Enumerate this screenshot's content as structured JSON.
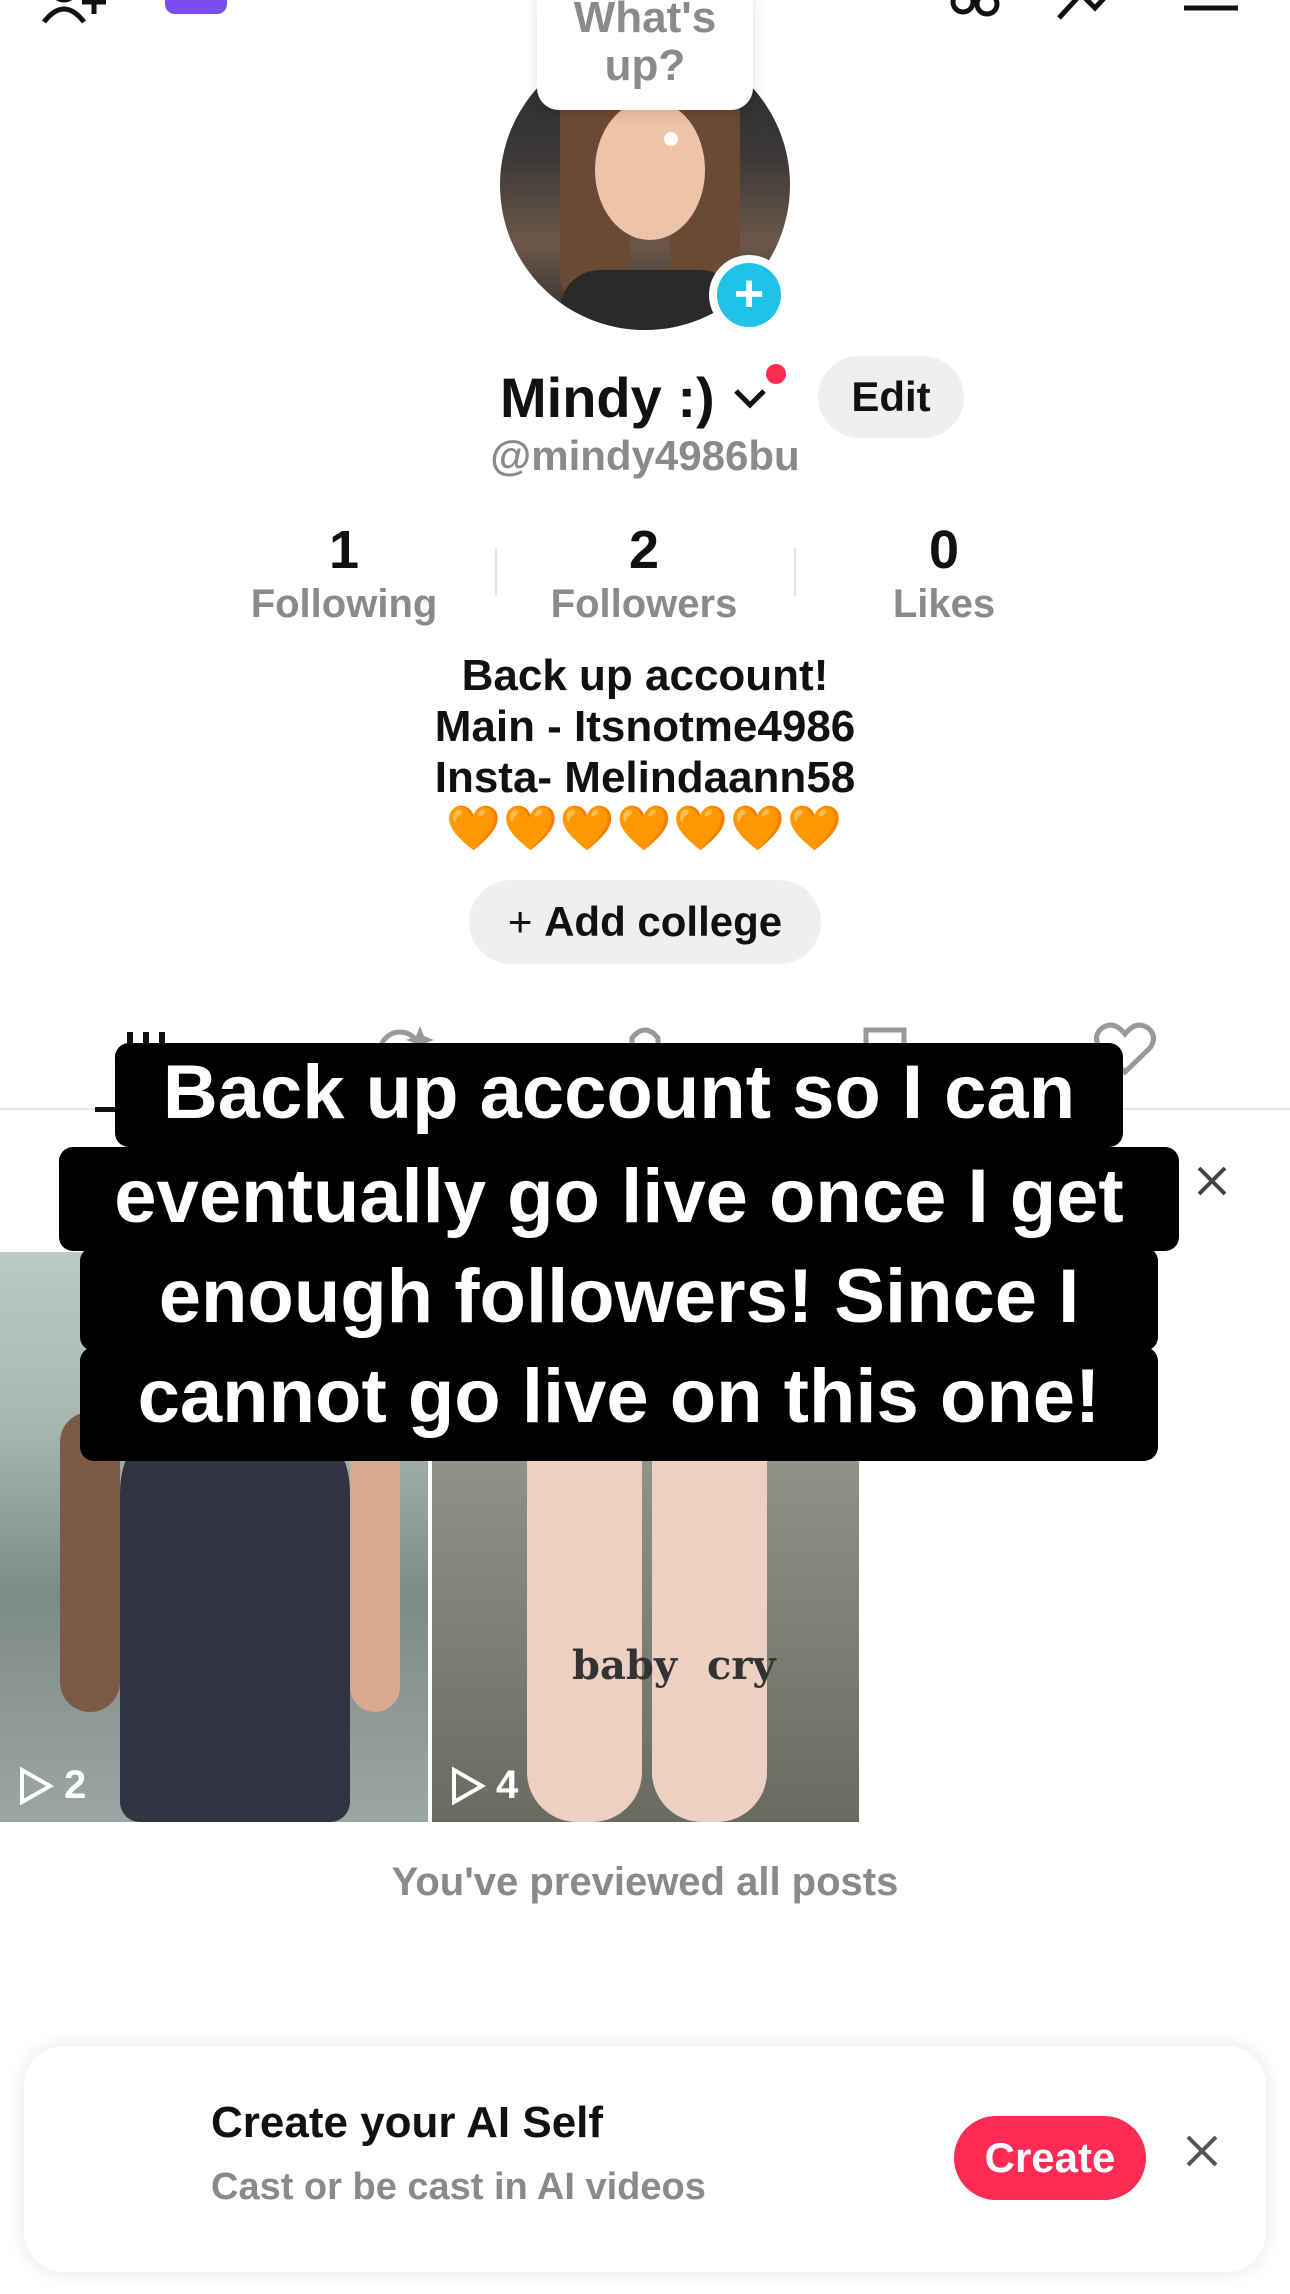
{
  "bubble": {
    "text_line1": "What's",
    "text_line2": "up?"
  },
  "profile": {
    "name": "Mindy :)",
    "handle": "@mindy4986bu",
    "edit_label": "Edit",
    "stats": [
      {
        "value": "1",
        "label": "Following"
      },
      {
        "value": "2",
        "label": "Followers"
      },
      {
        "value": "0",
        "label": "Likes"
      }
    ],
    "bio_lines": [
      "Back up account!",
      "Main - Itsnotme4986",
      "Insta- Melindaann58"
    ],
    "hearts": "🧡🧡🧡🧡🧡🧡🧡",
    "add_college_label": "Add college"
  },
  "caption_lines": [
    "Back up account so I can",
    "eventually go live once I get",
    "enough followers! Since I",
    "cannot go live on this one!"
  ],
  "videos": [
    {
      "views": "2",
      "tattoo": ""
    },
    {
      "views": "4",
      "tattoo_left": "baby",
      "tattoo_right": "cry"
    }
  ],
  "previewed_text": "You've previewed all posts",
  "ai_card": {
    "title": "Create your AI Self",
    "subtitle": "Cast or be cast in AI videos",
    "create_label": "Create"
  },
  "colors": {
    "accent": "#fe2c55",
    "add_blue": "#20c2e8",
    "heart": "#ff8a1c",
    "gray_text": "#8a8a8a"
  }
}
